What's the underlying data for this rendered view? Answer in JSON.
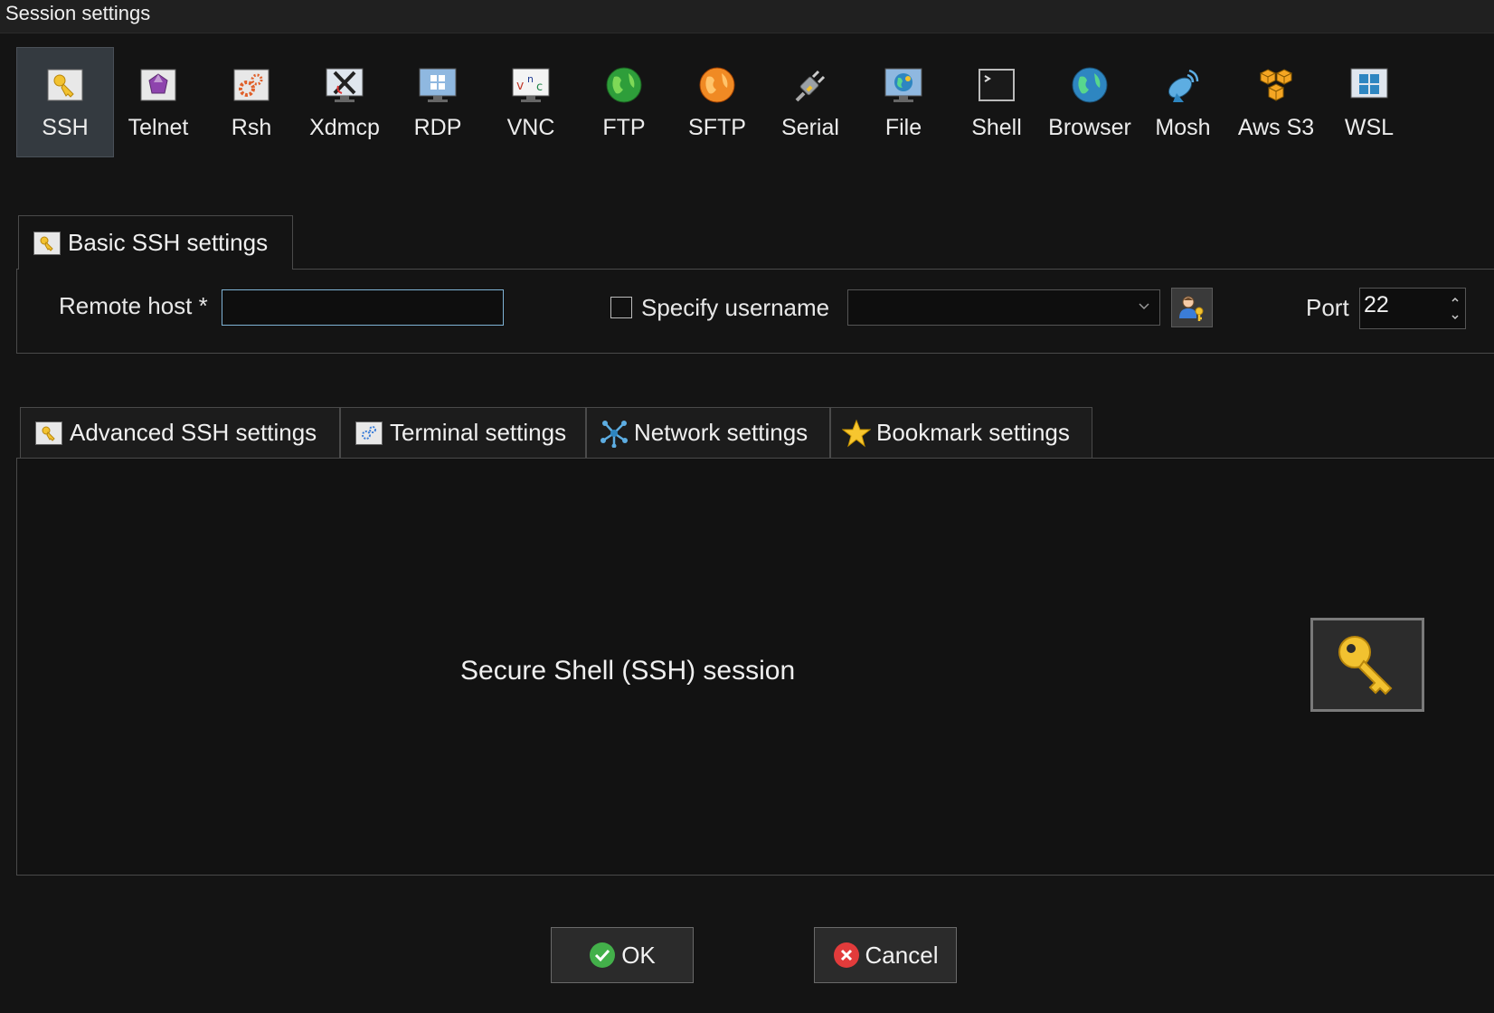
{
  "window": {
    "title": "Session settings"
  },
  "session_types": [
    {
      "label": "SSH",
      "icon": "ssh-key-icon",
      "active": true
    },
    {
      "label": "Telnet",
      "icon": "telnet-gem-icon"
    },
    {
      "label": "Rsh",
      "icon": "rsh-gears-icon"
    },
    {
      "label": "Xdmcp",
      "icon": "xdmcp-x-icon"
    },
    {
      "label": "RDP",
      "icon": "rdp-monitor-icon"
    },
    {
      "label": "VNC",
      "icon": "vnc-monitor-icon"
    },
    {
      "label": "FTP",
      "icon": "ftp-globe-icon"
    },
    {
      "label": "SFTP",
      "icon": "sftp-globe-icon"
    },
    {
      "label": "Serial",
      "icon": "serial-plug-icon"
    },
    {
      "label": "File",
      "icon": "file-globe-monitor-icon"
    },
    {
      "label": "Shell",
      "icon": "shell-terminal-icon"
    },
    {
      "label": "Browser",
      "icon": "browser-globe-icon"
    },
    {
      "label": "Mosh",
      "icon": "mosh-satellite-icon"
    },
    {
      "label": "Aws S3",
      "icon": "aws-s3-cubes-icon"
    },
    {
      "label": "WSL",
      "icon": "wsl-windows-icon"
    }
  ],
  "basic": {
    "tab_label": "Basic SSH settings",
    "remote_host_label": "Remote host *",
    "remote_host_value": "",
    "specify_username_label": "Specify username",
    "specify_username_checked": false,
    "username_value": "",
    "port_label": "Port",
    "port_value": "22"
  },
  "lower_tabs": [
    {
      "label": "Advanced SSH settings",
      "icon": "key-icon"
    },
    {
      "label": "Terminal settings",
      "icon": "terminal-gears-icon"
    },
    {
      "label": "Network settings",
      "icon": "network-icon"
    },
    {
      "label": "Bookmark settings",
      "icon": "star-icon"
    }
  ],
  "panel": {
    "description": "Secure Shell (SSH) session"
  },
  "buttons": {
    "ok": "OK",
    "cancel": "Cancel"
  },
  "colors": {
    "key_gold": "#f2c230",
    "ok_green": "#43b04a",
    "cancel_red": "#e23b3b"
  }
}
